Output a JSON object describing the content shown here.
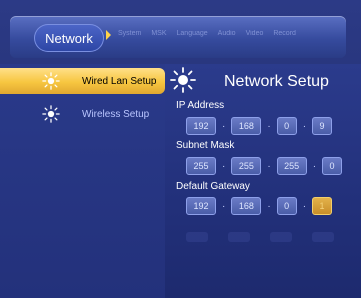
{
  "header": {
    "active_tab": "Network",
    "tabs": [
      "System",
      "MSK",
      "Language",
      "Audio",
      "Video",
      "Record"
    ]
  },
  "sidebar": {
    "items": [
      {
        "label": "Wired Lan Setup",
        "active": true
      },
      {
        "label": "Wireless Setup",
        "active": false
      }
    ]
  },
  "main": {
    "title": "Network Setup",
    "ip_address": {
      "label": "IP Address",
      "octets": [
        "192",
        "168",
        "0",
        "9"
      ]
    },
    "subnet_mask": {
      "label": "Subnet Mask",
      "octets": [
        "255",
        "255",
        "255",
        "0"
      ]
    },
    "default_gateway": {
      "label": "Default Gateway",
      "octets": [
        "192",
        "168",
        "0",
        "1"
      ]
    }
  },
  "colors": {
    "accent": "#f7c640",
    "background": "#263479",
    "banner": "#364b9e"
  }
}
